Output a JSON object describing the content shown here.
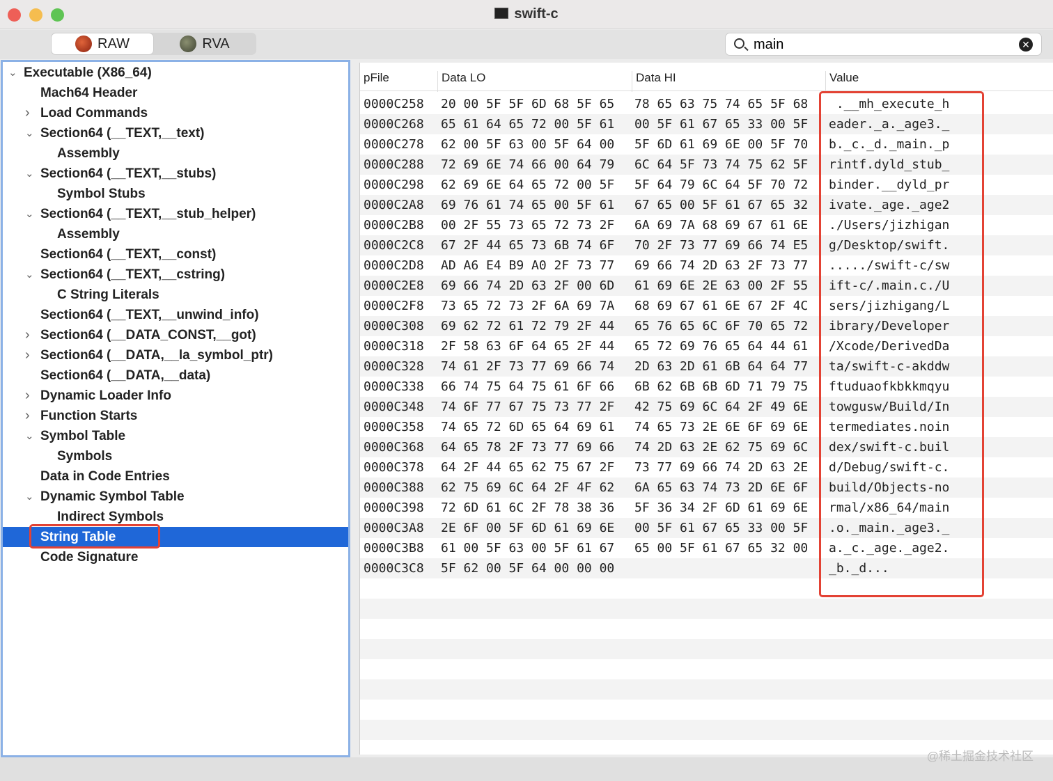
{
  "window": {
    "title": "swift-c"
  },
  "toolbar": {
    "raw_label": "RAW",
    "rva_label": "RVA",
    "search_value": "main"
  },
  "tree": [
    {
      "label": "Executable  (X86_64)",
      "level": 0,
      "chevron": "down"
    },
    {
      "label": "Mach64 Header",
      "level": 1,
      "chevron": ""
    },
    {
      "label": "Load Commands",
      "level": 1,
      "chevron": "right"
    },
    {
      "label": "Section64 (__TEXT,__text)",
      "level": 1,
      "chevron": "down"
    },
    {
      "label": "Assembly",
      "level": 2,
      "chevron": ""
    },
    {
      "label": "Section64 (__TEXT,__stubs)",
      "level": 1,
      "chevron": "down"
    },
    {
      "label": "Symbol Stubs",
      "level": 2,
      "chevron": ""
    },
    {
      "label": "Section64 (__TEXT,__stub_helper)",
      "level": 1,
      "chevron": "down"
    },
    {
      "label": "Assembly",
      "level": 2,
      "chevron": ""
    },
    {
      "label": "Section64 (__TEXT,__const)",
      "level": 1,
      "chevron": ""
    },
    {
      "label": "Section64 (__TEXT,__cstring)",
      "level": 1,
      "chevron": "down"
    },
    {
      "label": "C String Literals",
      "level": 2,
      "chevron": ""
    },
    {
      "label": "Section64 (__TEXT,__unwind_info)",
      "level": 1,
      "chevron": ""
    },
    {
      "label": "Section64 (__DATA_CONST,__got)",
      "level": 1,
      "chevron": "right"
    },
    {
      "label": "Section64 (__DATA,__la_symbol_ptr)",
      "level": 1,
      "chevron": "right"
    },
    {
      "label": "Section64 (__DATA,__data)",
      "level": 1,
      "chevron": ""
    },
    {
      "label": "Dynamic Loader Info",
      "level": 1,
      "chevron": "right"
    },
    {
      "label": "Function Starts",
      "level": 1,
      "chevron": "right"
    },
    {
      "label": "Symbol Table",
      "level": 1,
      "chevron": "down"
    },
    {
      "label": "Symbols",
      "level": 2,
      "chevron": ""
    },
    {
      "label": "Data in Code Entries",
      "level": 1,
      "chevron": ""
    },
    {
      "label": "Dynamic Symbol Table",
      "level": 1,
      "chevron": "down"
    },
    {
      "label": "Indirect Symbols",
      "level": 2,
      "chevron": ""
    },
    {
      "label": "String Table",
      "level": 1,
      "chevron": "",
      "selected": true
    },
    {
      "label": "Code Signature",
      "level": 1,
      "chevron": ""
    }
  ],
  "table": {
    "headers": [
      "pFile",
      "Data LO",
      "Data HI",
      "Value"
    ],
    "rows": [
      [
        "0000C258",
        "20 00 5F 5F 6D 68 5F 65",
        "78 65 63 75 74 65 5F 68",
        " .__mh_execute_h"
      ],
      [
        "0000C268",
        "65 61 64 65 72 00 5F 61",
        "00 5F 61 67 65 33 00 5F",
        "eader._a._age3._"
      ],
      [
        "0000C278",
        "62 00 5F 63 00 5F 64 00",
        "5F 6D 61 69 6E 00 5F 70",
        "b._c._d._main._p"
      ],
      [
        "0000C288",
        "72 69 6E 74 66 00 64 79",
        "6C 64 5F 73 74 75 62 5F",
        "rintf.dyld_stub_"
      ],
      [
        "0000C298",
        "62 69 6E 64 65 72 00 5F",
        "5F 64 79 6C 64 5F 70 72",
        "binder.__dyld_pr"
      ],
      [
        "0000C2A8",
        "69 76 61 74 65 00 5F 61",
        "67 65 00 5F 61 67 65 32",
        "ivate._age._age2"
      ],
      [
        "0000C2B8",
        "00 2F 55 73 65 72 73 2F",
        "6A 69 7A 68 69 67 61 6E",
        "./Users/jizhigan"
      ],
      [
        "0000C2C8",
        "67 2F 44 65 73 6B 74 6F",
        "70 2F 73 77 69 66 74 E5",
        "g/Desktop/swift."
      ],
      [
        "0000C2D8",
        "AD A6 E4 B9 A0 2F 73 77",
        "69 66 74 2D 63 2F 73 77",
        "...../swift-c/sw"
      ],
      [
        "0000C2E8",
        "69 66 74 2D 63 2F 00 6D",
        "61 69 6E 2E 63 00 2F 55",
        "ift-c/.main.c./U"
      ],
      [
        "0000C2F8",
        "73 65 72 73 2F 6A 69 7A",
        "68 69 67 61 6E 67 2F 4C",
        "sers/jizhigang/L"
      ],
      [
        "0000C308",
        "69 62 72 61 72 79 2F 44",
        "65 76 65 6C 6F 70 65 72",
        "ibrary/Developer"
      ],
      [
        "0000C318",
        "2F 58 63 6F 64 65 2F 44",
        "65 72 69 76 65 64 44 61",
        "/Xcode/DerivedDa"
      ],
      [
        "0000C328",
        "74 61 2F 73 77 69 66 74",
        "2D 63 2D 61 6B 64 64 77",
        "ta/swift-c-akddw"
      ],
      [
        "0000C338",
        "66 74 75 64 75 61 6F 66",
        "6B 62 6B 6B 6D 71 79 75",
        "ftuduaofkbkkmqyu"
      ],
      [
        "0000C348",
        "74 6F 77 67 75 73 77 2F",
        "42 75 69 6C 64 2F 49 6E",
        "towgusw/Build/In"
      ],
      [
        "0000C358",
        "74 65 72 6D 65 64 69 61",
        "74 65 73 2E 6E 6F 69 6E",
        "termediates.noin"
      ],
      [
        "0000C368",
        "64 65 78 2F 73 77 69 66",
        "74 2D 63 2E 62 75 69 6C",
        "dex/swift-c.buil"
      ],
      [
        "0000C378",
        "64 2F 44 65 62 75 67 2F",
        "73 77 69 66 74 2D 63 2E",
        "d/Debug/swift-c."
      ],
      [
        "0000C388",
        "62 75 69 6C 64 2F 4F 62",
        "6A 65 63 74 73 2D 6E 6F",
        "build/Objects-no"
      ],
      [
        "0000C398",
        "72 6D 61 6C 2F 78 38 36",
        "5F 36 34 2F 6D 61 69 6E",
        "rmal/x86_64/main"
      ],
      [
        "0000C3A8",
        "2E 6F 00 5F 6D 61 69 6E",
        "00 5F 61 67 65 33 00 5F",
        ".o._main._age3._"
      ],
      [
        "0000C3B8",
        "61 00 5F 63 00 5F 61 67",
        "65 00 5F 61 67 65 32 00",
        "a._c._age._age2."
      ],
      [
        "0000C3C8",
        "5F 62 00 5F 64 00 00 00",
        "",
        "_b._d..."
      ]
    ]
  },
  "watermark": "@稀土掘金技术社区",
  "colors": {
    "selection": "#1f67d8",
    "highlight": "#e34234",
    "sidebar_border": "#8bb1e6"
  }
}
